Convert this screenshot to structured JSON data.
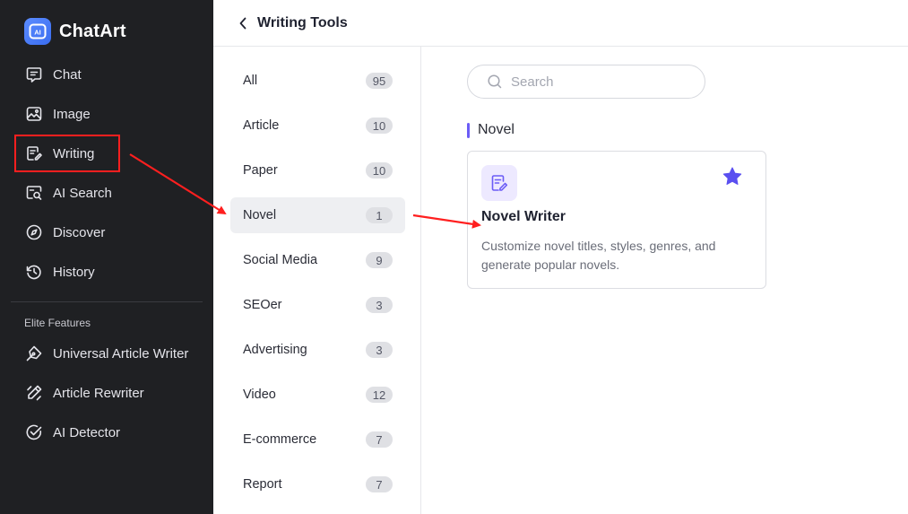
{
  "app": {
    "name": "ChatArt"
  },
  "sidebar": {
    "items": [
      {
        "label": "Chat",
        "icon": "chat-icon"
      },
      {
        "label": "Image",
        "icon": "image-icon"
      },
      {
        "label": "Writing",
        "icon": "writing-icon",
        "selected": true
      },
      {
        "label": "AI Search",
        "icon": "ai-search-icon"
      },
      {
        "label": "Discover",
        "icon": "compass-icon"
      },
      {
        "label": "History",
        "icon": "history-icon"
      }
    ],
    "section_label": "Elite Features",
    "elite_items": [
      {
        "label": "Universal Article Writer",
        "icon": "pen-nib-icon"
      },
      {
        "label": "Article Rewriter",
        "icon": "rewrite-icon"
      },
      {
        "label": "AI Detector",
        "icon": "check-circle-icon"
      }
    ]
  },
  "header": {
    "title": "Writing Tools"
  },
  "categories": [
    {
      "label": "All",
      "count": "95"
    },
    {
      "label": "Article",
      "count": "10"
    },
    {
      "label": "Paper",
      "count": "10"
    },
    {
      "label": "Novel",
      "count": "1",
      "active": true
    },
    {
      "label": "Social Media",
      "count": "9"
    },
    {
      "label": "SEOer",
      "count": "3"
    },
    {
      "label": "Advertising",
      "count": "3"
    },
    {
      "label": "Video",
      "count": "12"
    },
    {
      "label": "E-commerce",
      "count": "7"
    },
    {
      "label": "Report",
      "count": "7"
    }
  ],
  "search": {
    "placeholder": "Search",
    "value": ""
  },
  "section": {
    "title": "Novel"
  },
  "tool_card": {
    "title": "Novel Writer",
    "description": "Customize novel titles, styles, genres, and generate popular novels.",
    "favorited": true
  },
  "colors": {
    "sidebar_bg": "#1f2023",
    "accent": "#6b5cf6",
    "annotation": "#ff1f1f"
  }
}
